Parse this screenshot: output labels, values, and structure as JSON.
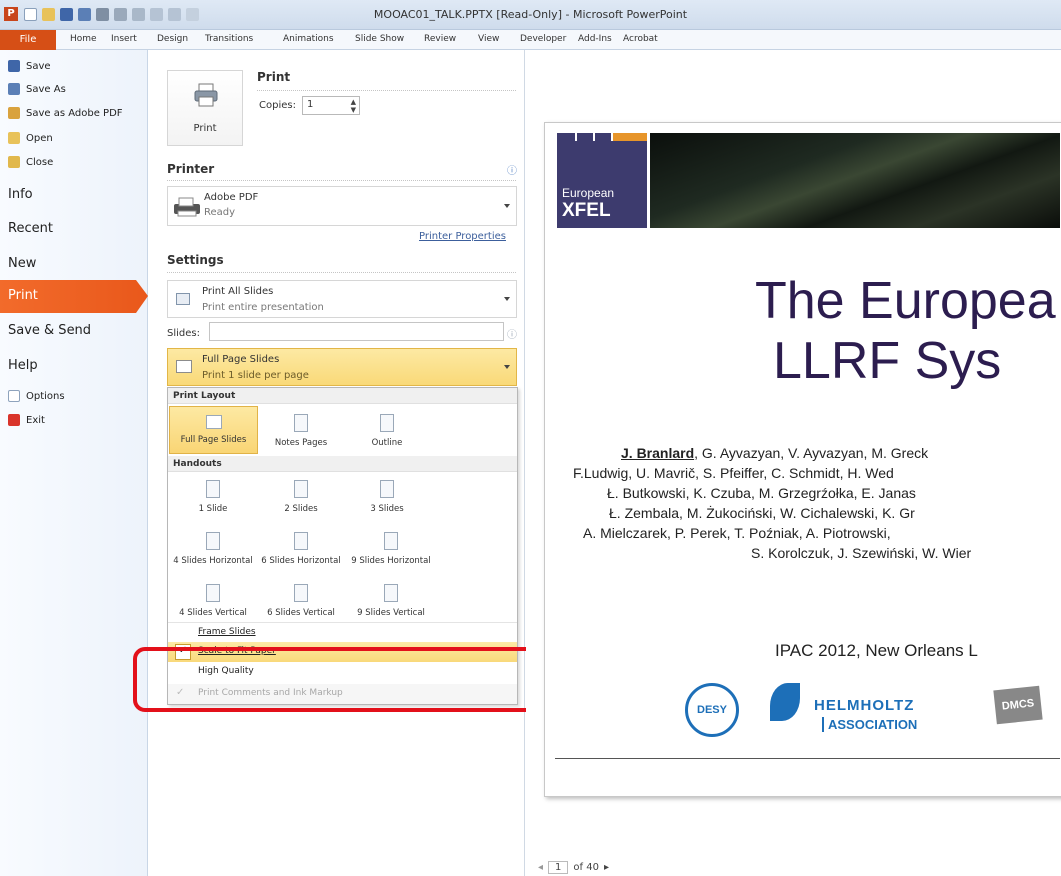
{
  "window": {
    "title": "MOOAC01_TALK.PPTX [Read-Only]  -  Microsoft PowerPoint",
    "app_badge": "P"
  },
  "ribbon": {
    "tabs": [
      "File",
      "Home",
      "Insert",
      "Design",
      "Transitions",
      "Animations",
      "Slide Show",
      "Review",
      "View",
      "Developer",
      "Add-Ins",
      "Acrobat"
    ]
  },
  "backstage": {
    "small": [
      "Save",
      "Save As",
      "Save as Adobe PDF",
      "Open",
      "Close"
    ],
    "big": [
      "Info",
      "Recent",
      "New",
      "Print",
      "Save & Send",
      "Help"
    ],
    "bottom": [
      "Options",
      "Exit"
    ]
  },
  "print": {
    "heading": "Print",
    "button_label": "Print",
    "copies_label": "Copies:",
    "copies_value": "1",
    "printer_heading": "Printer",
    "printer_name": "Adobe PDF",
    "printer_status": "Ready",
    "printer_properties": "Printer Properties",
    "settings_heading": "Settings",
    "range_title": "Print All Slides",
    "range_sub": "Print entire presentation",
    "slides_label": "Slides:",
    "layout_title": "Full Page Slides",
    "layout_sub": "Print 1 slide per page",
    "info_glyph": "ⓘ"
  },
  "popup": {
    "layout_header": "Print Layout",
    "layout_items": [
      "Full Page Slides",
      "Notes Pages",
      "Outline"
    ],
    "handouts_header": "Handouts",
    "handouts_row1": [
      "1 Slide",
      "2 Slides",
      "3 Slides"
    ],
    "handouts_row2": [
      "4 Slides Horizontal",
      "6 Slides Horizontal",
      "9 Slides Horizontal"
    ],
    "handouts_row3": [
      "4 Slides Vertical",
      "6 Slides Vertical",
      "9 Slides Vertical"
    ],
    "frame": "Frame Slides",
    "scale": "Scale to Fit Paper",
    "quality": "High Quality",
    "comments": "Print Comments and Ink Markup",
    "check": "✓"
  },
  "highlight_color": "#e3101a",
  "slide": {
    "org_line1": "European",
    "org_line2": "XFEL",
    "title_line1": "The Europea",
    "title_line2": "LLRF Sys",
    "author_lead": "J. Branlard",
    "authors": [
      ", G. Ayvazyan, V. Ayvazyan, M. Greck",
      "F.Ludwig, U. Mavrič, S. Pfeiffer, C. Schmidt, H. Wed",
      "Ł. Butkowski, K. Czuba, M. Grzegrźołka, E. Janas",
      "Ł. Zembala, M. Żukociński, W. Cichalewski, K. Gr",
      "A. Mielczarek, P. Perek, T. Poźniak, A. Piotrowski,",
      "S. Korolczuk, J. Szewiński, W. Wier"
    ],
    "venue": "IPAC 2012, New Orleans L",
    "logo_desy": "DESY",
    "logo_helmholtz1": "HELMHOLTZ",
    "logo_helmholtz2": "ASSOCIATION",
    "logo_dmcs": "DMCS"
  },
  "pager": {
    "page": "1",
    "of": "of 40",
    "prev": "◂",
    "next": "▸"
  }
}
